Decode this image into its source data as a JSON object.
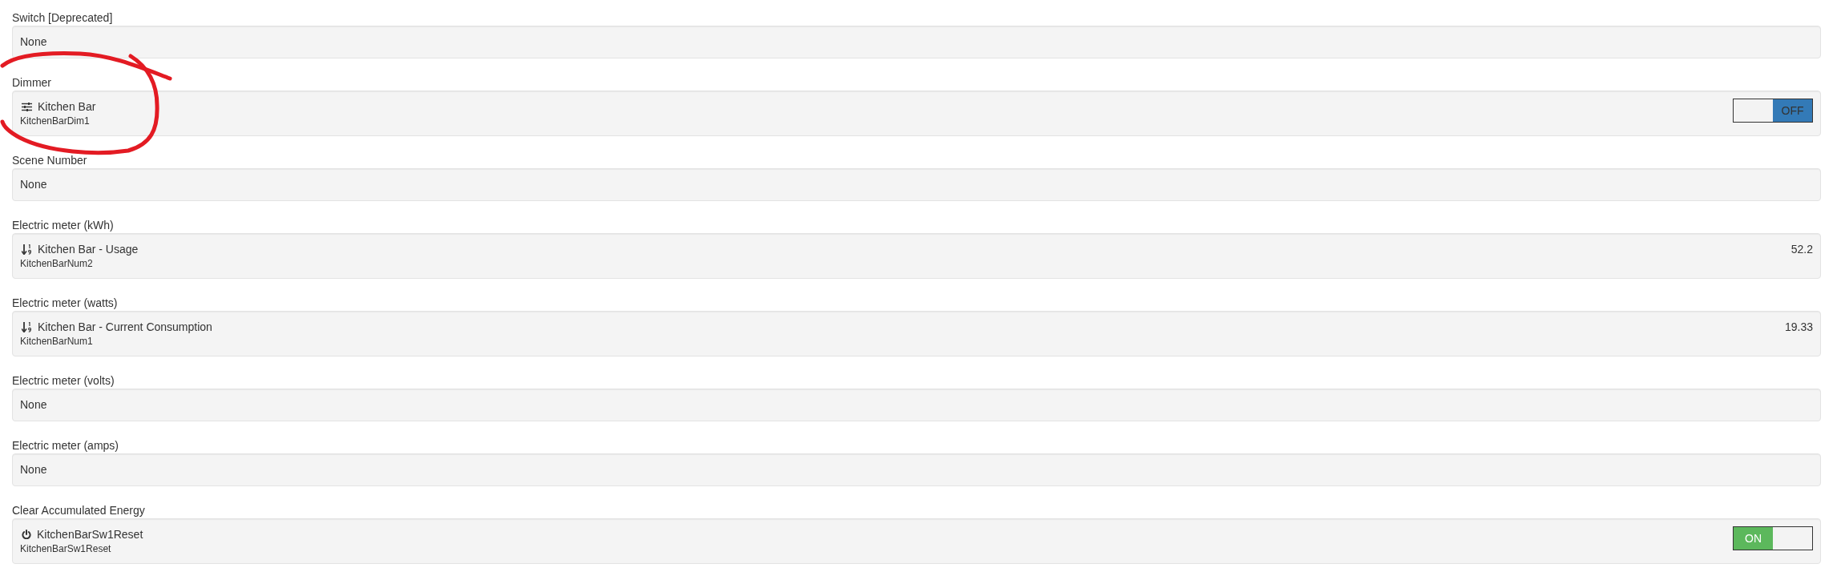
{
  "fields": [
    {
      "label": "Switch [Deprecated]",
      "kind": "none",
      "text": "None"
    },
    {
      "label": "Dimmer",
      "kind": "dimmer",
      "item": {
        "title": "Kitchen Bar",
        "name": "KitchenBarDim1",
        "toggle": {
          "on": false,
          "label": "OFF"
        }
      }
    },
    {
      "label": "Scene Number",
      "kind": "none",
      "text": "None"
    },
    {
      "label": "Electric meter (kWh)",
      "kind": "number",
      "item": {
        "title": "Kitchen Bar - Usage",
        "name": "KitchenBarNum2",
        "value": "52.2"
      }
    },
    {
      "label": "Electric meter (watts)",
      "kind": "number",
      "item": {
        "title": "Kitchen Bar - Current Consumption",
        "name": "KitchenBarNum1",
        "value": "19.33"
      }
    },
    {
      "label": "Electric meter (volts)",
      "kind": "none",
      "text": "None"
    },
    {
      "label": "Electric meter (amps)",
      "kind": "none",
      "text": "None"
    },
    {
      "label": "Clear Accumulated Energy",
      "kind": "switch",
      "item": {
        "title": "KitchenBarSw1Reset",
        "name": "KitchenBarSw1Reset",
        "toggle": {
          "on": true,
          "label": "ON"
        }
      }
    }
  ]
}
